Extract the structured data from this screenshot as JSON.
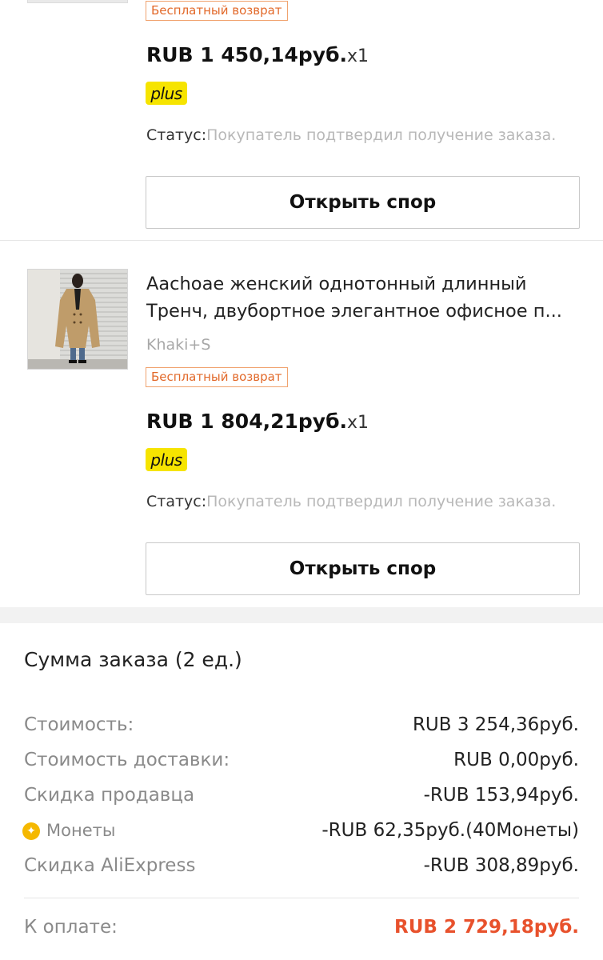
{
  "items": [
    {
      "badge": "Бесплатный возврат",
      "price": "RUB 1 450,14руб.",
      "qty": "x1",
      "plus": "plus",
      "status_label": "Статус:",
      "status_value": "Покупатель подтвердил получение заказа.",
      "dispute_button": "Открыть спор"
    },
    {
      "title_line1": "Aachoae женский однотонный длинный",
      "title_line2": "Тренч, двубортное элегантное офисное п...",
      "variant": "Khaki+S",
      "badge": "Бесплатный возврат",
      "price": "RUB 1 804,21руб.",
      "qty": "x1",
      "plus": "plus",
      "status_label": "Статус:",
      "status_value": "Покупатель подтвердил получение заказа.",
      "dispute_button": "Открыть спор"
    }
  ],
  "summary": {
    "title": "Сумма заказа (2 ед.)",
    "rows": [
      {
        "label": "Стоимость:",
        "value": "RUB 3 254,36руб."
      },
      {
        "label": "Стоимость доставки:",
        "value": "RUB 0,00руб."
      },
      {
        "label": "Скидка продавца",
        "value": "-RUB 153,94руб."
      },
      {
        "label": "Монеты",
        "value": "-RUB 62,35руб.(40Монеты)",
        "icon": "coin-icon"
      },
      {
        "label": "Скидка AliExpress",
        "value": "-RUB 308,89руб."
      }
    ],
    "total_label": "К оплате:",
    "total_value": "RUB 2 729,18руб."
  },
  "colors": {
    "accent": "#e8512c",
    "badge_border": "#f0a36f",
    "plus_yellow": "#f6e400",
    "coin": "#f5b800"
  }
}
